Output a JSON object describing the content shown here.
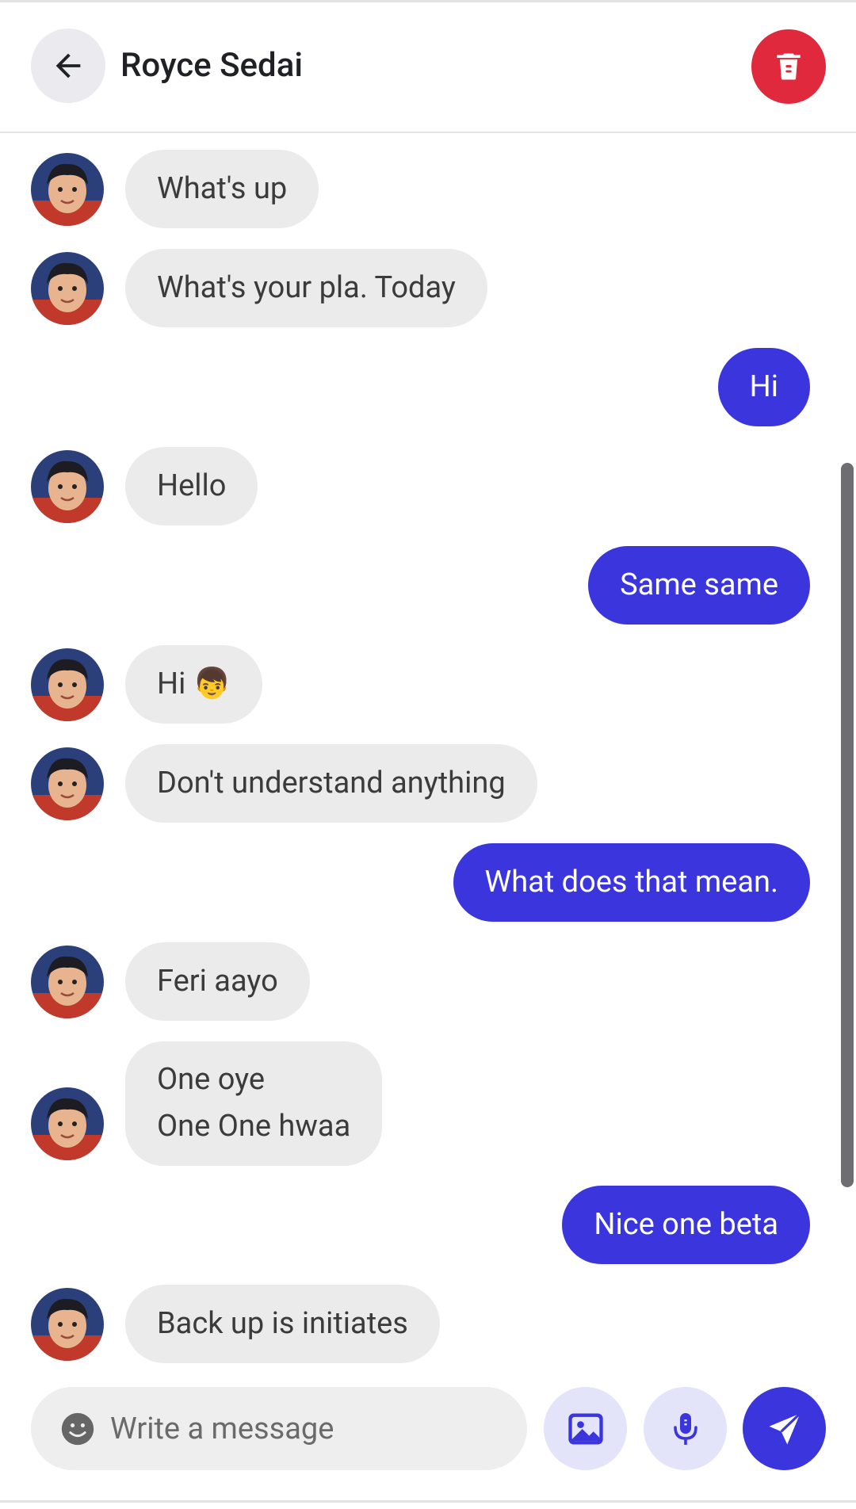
{
  "header": {
    "title": "Royce Sedai"
  },
  "messages": [
    {
      "side": "in",
      "text": "What's up"
    },
    {
      "side": "in",
      "text": "What's your pla. Today"
    },
    {
      "side": "out",
      "text": "Hi"
    },
    {
      "side": "in",
      "text": "Hello"
    },
    {
      "side": "out",
      "text": "Same same"
    },
    {
      "side": "in",
      "text": "Hi 👦"
    },
    {
      "side": "in",
      "text": "Don't understand anything"
    },
    {
      "side": "out",
      "text": "What does that mean."
    },
    {
      "side": "in",
      "text": "Feri aayo"
    },
    {
      "side": "in",
      "line1": "One oye",
      "line2": "One One hwaa"
    },
    {
      "side": "out",
      "text": "Nice one beta"
    },
    {
      "side": "in",
      "text": "Back up is initiates"
    }
  ],
  "composer": {
    "placeholder": "Write a message",
    "value": ""
  },
  "icons": {
    "back": "arrow-left-icon",
    "delete": "trash-icon",
    "emoji": "emoji-icon",
    "image": "image-icon",
    "mic": "mic-icon",
    "send": "send-icon"
  },
  "colors": {
    "accent": "#3b35de",
    "delete": "#e0293d",
    "incoming_bubble": "#ebebeb",
    "icon_button_bg": "#e3e3fa"
  }
}
